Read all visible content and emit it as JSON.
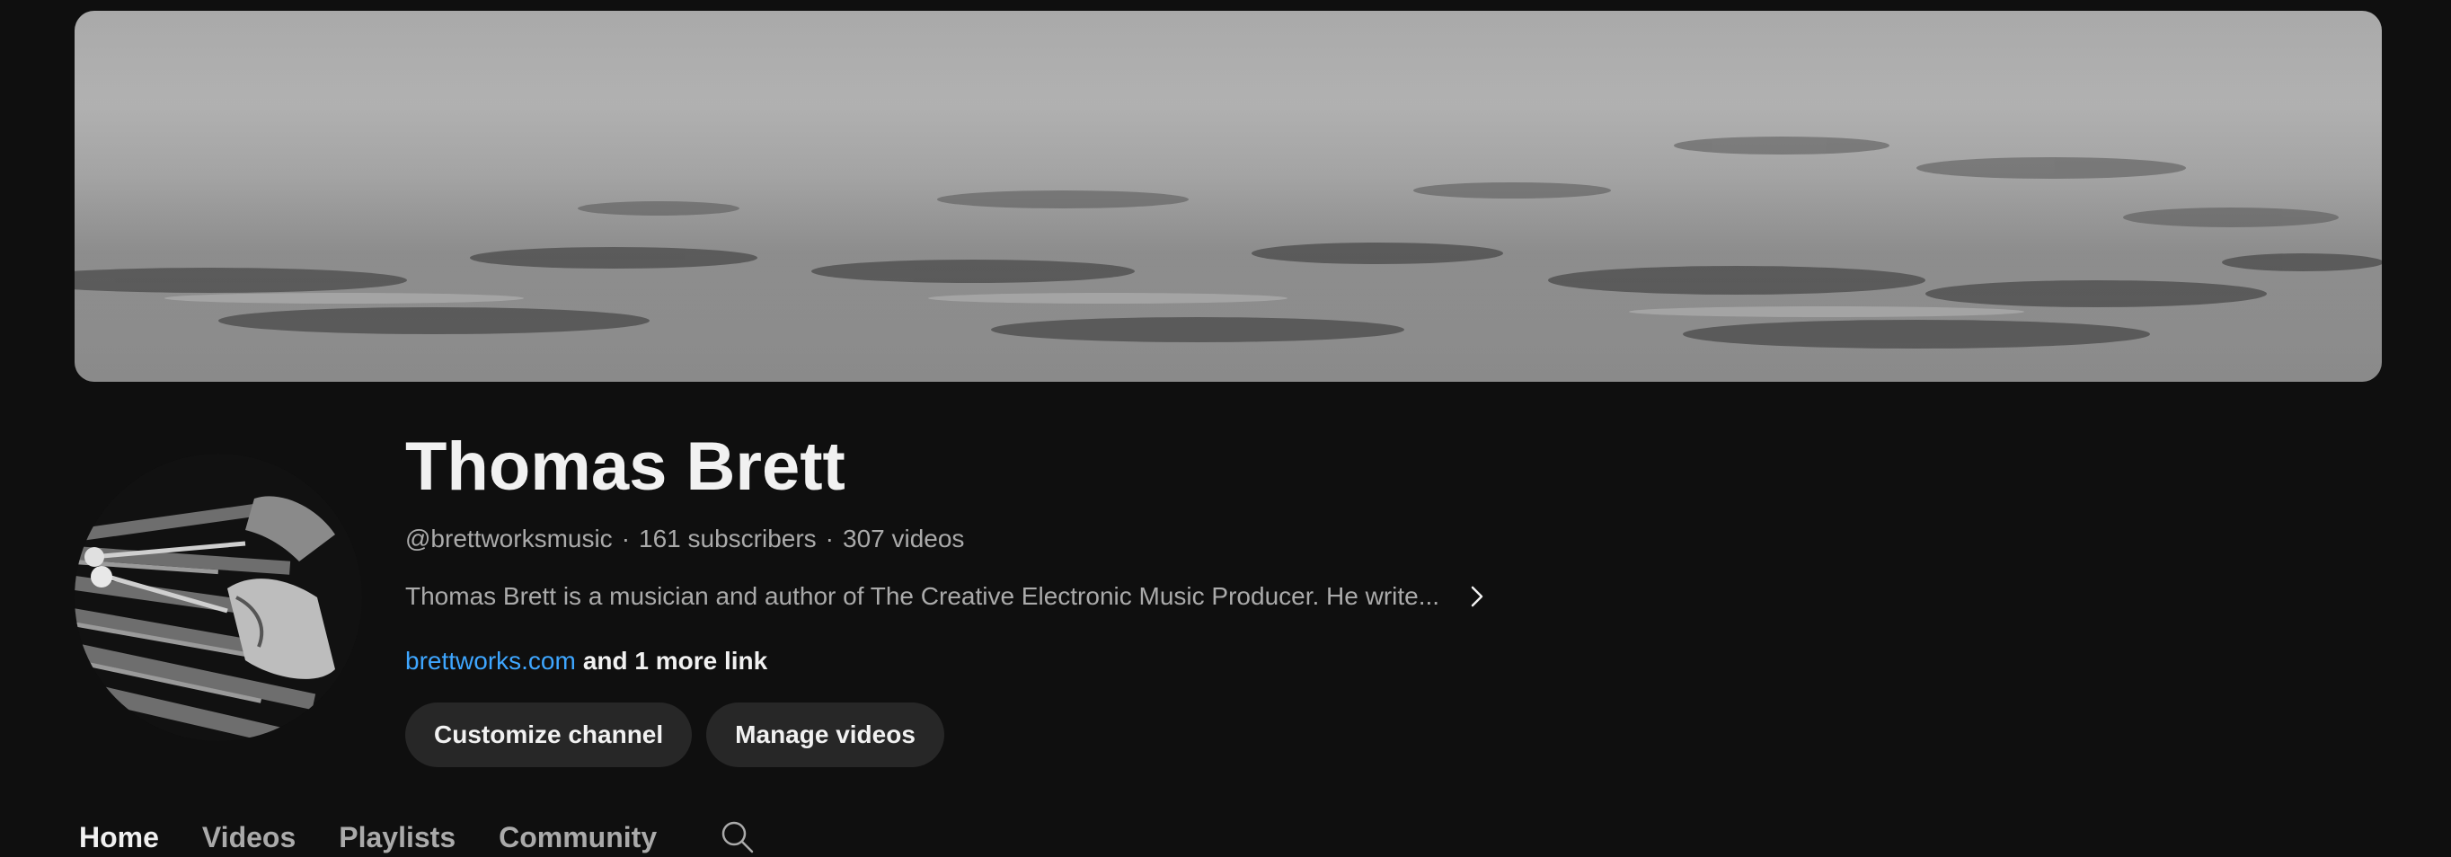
{
  "channel": {
    "name": "Thomas Brett",
    "handle": "@brettworksmusic",
    "subscribers": "161 subscribers",
    "videos": "307 videos",
    "separator": "·",
    "description": "Thomas Brett is a musician and author of The Creative Electronic Music Producer. He write...",
    "link_text": "brettworks.com",
    "more_links": "and 1 more link"
  },
  "actions": {
    "customize_label": "Customize channel",
    "manage_label": "Manage videos"
  },
  "tabs": [
    {
      "label": "Home",
      "active": true
    },
    {
      "label": "Videos",
      "active": false
    },
    {
      "label": "Playlists",
      "active": false
    },
    {
      "label": "Community",
      "active": false
    }
  ],
  "icons": {
    "description_expand": "chevron-right-icon",
    "tab_search": "search-icon"
  },
  "colors": {
    "background": "#0f0f0f",
    "link": "#3ea6ff",
    "button_bg": "#272727",
    "secondary_text": "#aaaaaa"
  }
}
